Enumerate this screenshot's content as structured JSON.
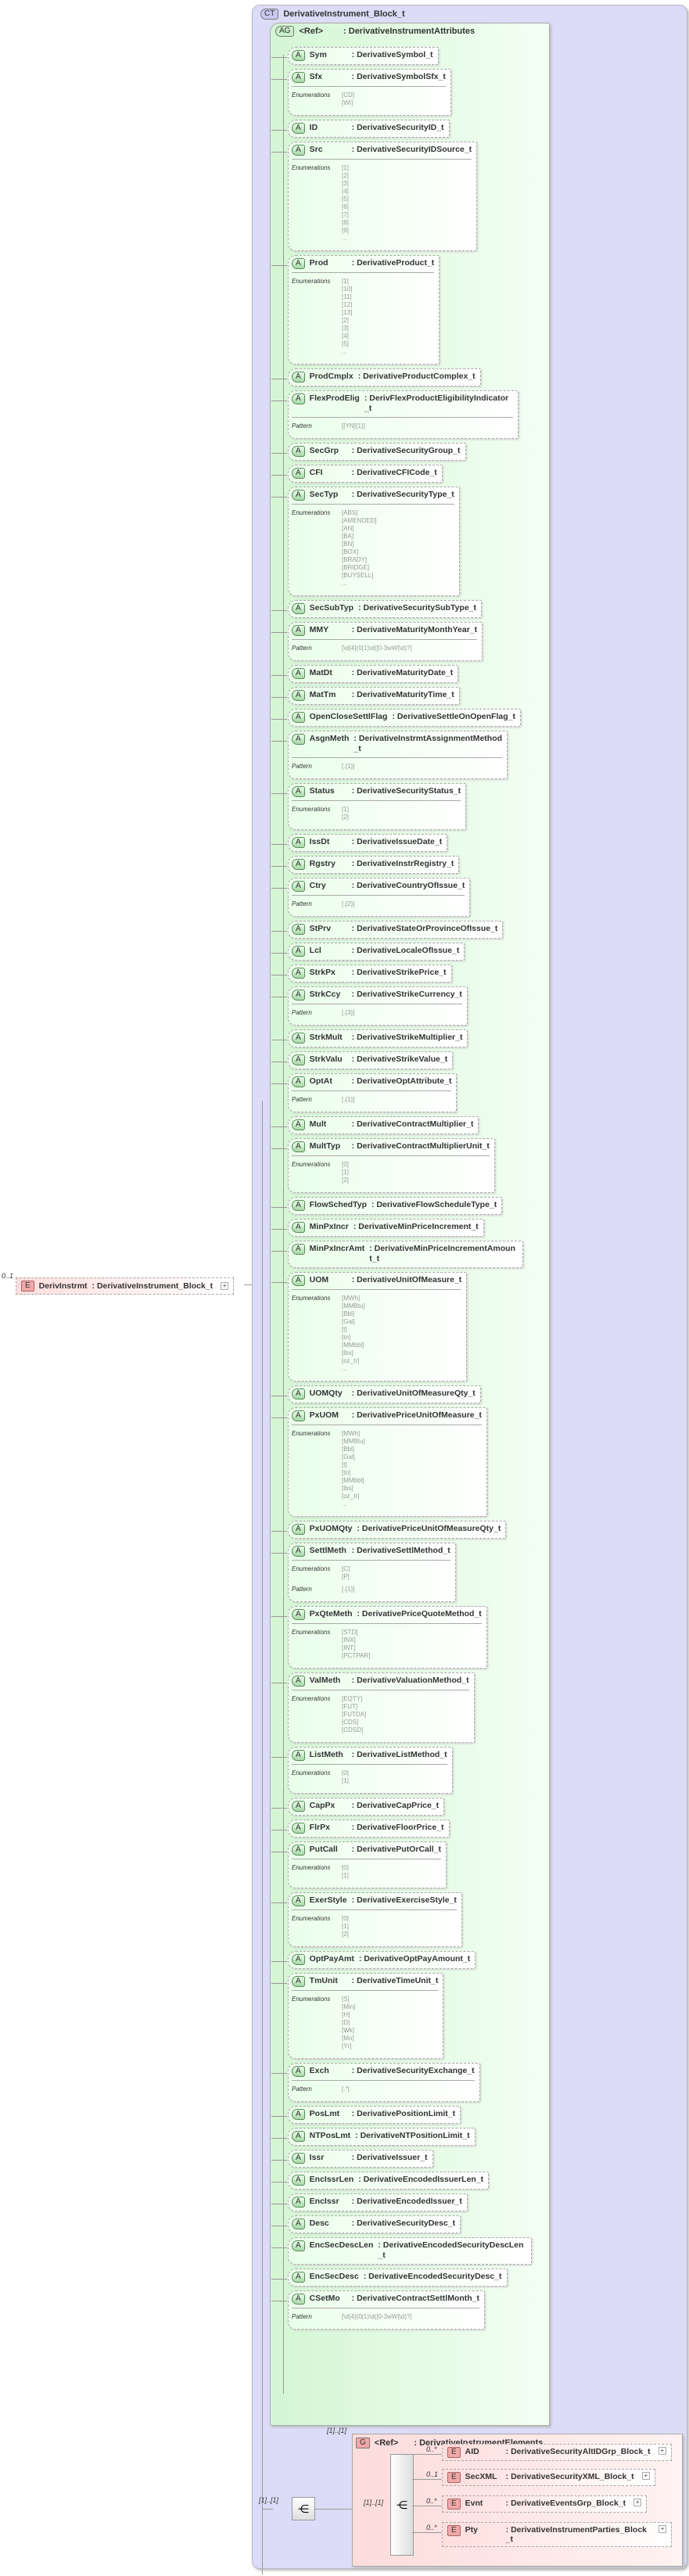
{
  "root": {
    "badge": "CT",
    "title": "DerivativeInstrument_Block_t"
  },
  "attr_group": {
    "badge": "AG",
    "ref": "<Ref>",
    "name": ": DerivativeInstrumentAttributes"
  },
  "labels": {
    "enumerations": "Enumerations",
    "pattern": "Pattern",
    "attr_badge": "A"
  },
  "attributes": [
    {
      "name": "Sym",
      "type": ": DerivativeSymbol_t"
    },
    {
      "name": "Sfx",
      "type": ": DerivativeSymbolSfx_t",
      "enums": [
        "[CD]",
        "[WI]"
      ]
    },
    {
      "name": "ID",
      "type": ": DerivativeSecurityID_t"
    },
    {
      "name": "Src",
      "type": ": DerivativeSecurityIDSource_t",
      "enums": [
        "[1]",
        "[2]",
        "[3]",
        "[4]",
        "[5]",
        "[6]",
        "[7]",
        "[8]",
        "[9]",
        "..."
      ]
    },
    {
      "name": "Prod",
      "type": ": DerivativeProduct_t",
      "enums": [
        "[1]",
        "[10]",
        "[11]",
        "[12]",
        "[13]",
        "[2]",
        "[3]",
        "[4]",
        "[5]",
        "..."
      ]
    },
    {
      "name": "ProdCmplx",
      "type": ": DerivativeProductComplex_t"
    },
    {
      "name": "FlexProdElig",
      "type": ": DerivFlexProductEligibilityIndicator_t",
      "pattern": "[[YN]{1}]"
    },
    {
      "name": "SecGrp",
      "type": ": DerivativeSecurityGroup_t"
    },
    {
      "name": "CFI",
      "type": ": DerivativeCFICode_t"
    },
    {
      "name": "SecTyp",
      "type": ": DerivativeSecurityType_t",
      "enums": [
        "[ABS]",
        "[AMENDED]",
        "[AN]",
        "[BA]",
        "[BN]",
        "[BOX]",
        "[BRADY]",
        "[BRIDGE]",
        "[BUYSELL]",
        "..."
      ]
    },
    {
      "name": "SecSubTyp",
      "type": ": DerivativeSecuritySubType_t"
    },
    {
      "name": "MMY",
      "type": ": DerivativeMaturityMonthYear_t",
      "pattern": "[\\d{4}(0|1)\\d([0-3wW]\\d)?]"
    },
    {
      "name": "MatDt",
      "type": ": DerivativeMaturityDate_t"
    },
    {
      "name": "MatTm",
      "type": ": DerivativeMaturityTime_t"
    },
    {
      "name": "OpenCloseSettlFlag",
      "type": ": DerivativeSettleOnOpenFlag_t"
    },
    {
      "name": "AsgnMeth",
      "type": ": DerivativeInstrmtAssignmentMethod_t",
      "pattern": "[.{1}]"
    },
    {
      "name": "Status",
      "type": ": DerivativeSecurityStatus_t",
      "enums": [
        "[1]",
        "[2]"
      ]
    },
    {
      "name": "IssDt",
      "type": ": DerivativeIssueDate_t"
    },
    {
      "name": "Rgstry",
      "type": ": DerivativeInstrRegistry_t"
    },
    {
      "name": "Ctry",
      "type": ": DerivativeCountryOfIssue_t",
      "pattern": "[.{2}]"
    },
    {
      "name": "StPrv",
      "type": ": DerivativeStateOrProvinceOfIssue_t"
    },
    {
      "name": "Lcl",
      "type": ": DerivativeLocaleOfIssue_t"
    },
    {
      "name": "StrkPx",
      "type": ": DerivativeStrikePrice_t"
    },
    {
      "name": "StrkCcy",
      "type": ": DerivativeStrikeCurrency_t",
      "pattern": "[.{3}]"
    },
    {
      "name": "StrkMult",
      "type": ": DerivativeStrikeMultiplier_t"
    },
    {
      "name": "StrkValu",
      "type": ": DerivativeStrikeValue_t"
    },
    {
      "name": "OptAt",
      "type": ": DerivativeOptAttribute_t",
      "pattern": "[.{1}]"
    },
    {
      "name": "Mult",
      "type": ": DerivativeContractMultiplier_t"
    },
    {
      "name": "MultTyp",
      "type": ": DerivativeContractMultiplierUnit_t",
      "enums": [
        "[0]",
        "[1]",
        "[2]"
      ]
    },
    {
      "name": "FlowSchedTyp",
      "type": ": DerivativeFlowScheduleType_t"
    },
    {
      "name": "MinPxIncr",
      "type": ": DerivativeMinPriceIncrement_t"
    },
    {
      "name": "MinPxIncrAmt",
      "type": ": DerivativeMinPriceIncrementAmount_t"
    },
    {
      "name": "UOM",
      "type": ": DerivativeUnitOfMeasure_t",
      "enums": [
        "[MWh]",
        "[MMBtu]",
        "[Bbl]",
        "[Gal]",
        "[t]",
        "[tn]",
        "[MMbbl]",
        "[lbs]",
        "[oz_tr]",
        "..."
      ]
    },
    {
      "name": "UOMQty",
      "type": ": DerivativeUnitOfMeasureQty_t"
    },
    {
      "name": "PxUOM",
      "type": ": DerivativePriceUnitOfMeasure_t",
      "enums": [
        "[MWh]",
        "[MMBtu]",
        "[Bbl]",
        "[Gal]",
        "[t]",
        "[tn]",
        "[MMbbl]",
        "[lbs]",
        "[oz_tr]",
        "..."
      ]
    },
    {
      "name": "PxUOMQty",
      "type": ": DerivativePriceUnitOfMeasureQty_t"
    },
    {
      "name": "SettlMeth",
      "type": ": DerivativeSettlMethod_t",
      "enums": [
        "[C]",
        "[P]"
      ],
      "pattern": "[.{1}]"
    },
    {
      "name": "PxQteMeth",
      "type": ": DerivativePriceQuoteMethod_t",
      "enums": [
        "[STD]",
        "[INX]",
        "[INT]",
        "[PCTPAR]"
      ]
    },
    {
      "name": "ValMeth",
      "type": ": DerivativeValuationMethod_t",
      "enums": [
        "[EQTY]",
        "[FUT]",
        "[FUTDA]",
        "[CDS]",
        "[CDSD]"
      ]
    },
    {
      "name": "ListMeth",
      "type": ": DerivativeListMethod_t",
      "enums": [
        "[0]",
        "[1]"
      ]
    },
    {
      "name": "CapPx",
      "type": ": DerivativeCapPrice_t"
    },
    {
      "name": "FlrPx",
      "type": ": DerivativeFloorPrice_t"
    },
    {
      "name": "PutCall",
      "type": ": DerivativePutOrCall_t",
      "enums": [
        "[0]",
        "[1]"
      ]
    },
    {
      "name": "ExerStyle",
      "type": ": DerivativeExerciseStyle_t",
      "enums": [
        "[0]",
        "[1]",
        "[2]"
      ]
    },
    {
      "name": "OptPayAmt",
      "type": ": DerivativeOptPayAmount_t"
    },
    {
      "name": "TmUnit",
      "type": ": DerivativeTimeUnit_t",
      "enums": [
        "[S]",
        "[Min]",
        "[H]",
        "[D]",
        "[Wk]",
        "[Mo]",
        "[Yr]"
      ]
    },
    {
      "name": "Exch",
      "type": ": DerivativeSecurityExchange_t",
      "pattern": "[.*]"
    },
    {
      "name": "PosLmt",
      "type": ": DerivativePositionLimit_t"
    },
    {
      "name": "NTPosLmt",
      "type": ": DerivativeNTPositionLimit_t"
    },
    {
      "name": "Issr",
      "type": ": DerivativeIssuer_t"
    },
    {
      "name": "EncIssrLen",
      "type": ": DerivativeEncodedIssuerLen_t"
    },
    {
      "name": "EncIssr",
      "type": ": DerivativeEncodedIssuer_t"
    },
    {
      "name": "Desc",
      "type": ": DerivativeSecurityDesc_t"
    },
    {
      "name": "EncSecDescLen",
      "type": ": DerivativeEncodedSecurityDescLen_t"
    },
    {
      "name": "EncSecDesc",
      "type": ": DerivativeEncodedSecurityDesc_t"
    },
    {
      "name": "CSetMo",
      "type": ": DerivativeContractSettlMonth_t",
      "pattern": "[\\d{4}(0|1)\\d([0-3wW]\\d)?]"
    }
  ],
  "parent_element": {
    "badge": "E",
    "cardinality": "0..1",
    "name": "DerivInstrmt",
    "type": ": DerivativeInstrument_Block_t"
  },
  "sequence": {
    "cardinality": "[1]..[1]",
    "icon": "sequence-icon"
  },
  "element_group": {
    "badge": "G",
    "ref": "<Ref>",
    "name": ": DerivativeInstrumentElements",
    "cardinality": "[1]..[1]",
    "seq_cardinality": "[1]..[1]",
    "elements": [
      {
        "cardinality": "0..*",
        "name": "AID",
        "type": ": DerivativeSecurityAltIDGrp_Block_t"
      },
      {
        "cardinality": "0..1",
        "name": "SecXML",
        "type": ": DerivativeSecurityXML_Block_t"
      },
      {
        "cardinality": "0..*",
        "name": "Evnt",
        "type": ": DerivativeEventsGrp_Block_t"
      },
      {
        "cardinality": "0..*",
        "name": "Pty",
        "type": ": DerivativeInstrumentParties_Block_t"
      }
    ]
  },
  "element_badge": "E",
  "expand_symbol": "+"
}
